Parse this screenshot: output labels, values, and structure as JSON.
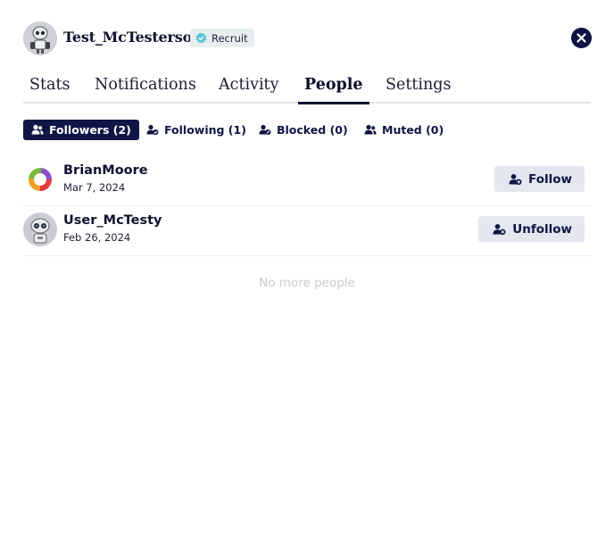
{
  "profile": {
    "username": "Test_McTesterson",
    "badge_label": "Recruit",
    "close_label": "Close"
  },
  "tabs": [
    {
      "label": "Stats",
      "active": false
    },
    {
      "label": "Notifications",
      "active": false
    },
    {
      "label": "Activity",
      "active": false
    },
    {
      "label": "People",
      "active": true
    },
    {
      "label": "Settings",
      "active": false
    }
  ],
  "subtabs": [
    {
      "label": "Followers (2)",
      "active": true
    },
    {
      "label": "Following (1)",
      "active": false
    },
    {
      "label": "Blocked (0)",
      "active": false
    },
    {
      "label": "Muted (0)",
      "active": false
    }
  ],
  "people": [
    {
      "name": "BrianMoore",
      "date": "Mar 7, 2024",
      "action": "Follow",
      "avatar": "ring-logo"
    },
    {
      "name": "User_McTesty",
      "date": "Feb 26, 2024",
      "action": "Unfollow",
      "avatar": "robot"
    }
  ],
  "empty_text": "No more people",
  "colors": {
    "primary": "#0f1545",
    "button_bg": "#e4e6f0",
    "badge_bg": "#e8eef0",
    "badge_icon": "#5cc6d0"
  }
}
